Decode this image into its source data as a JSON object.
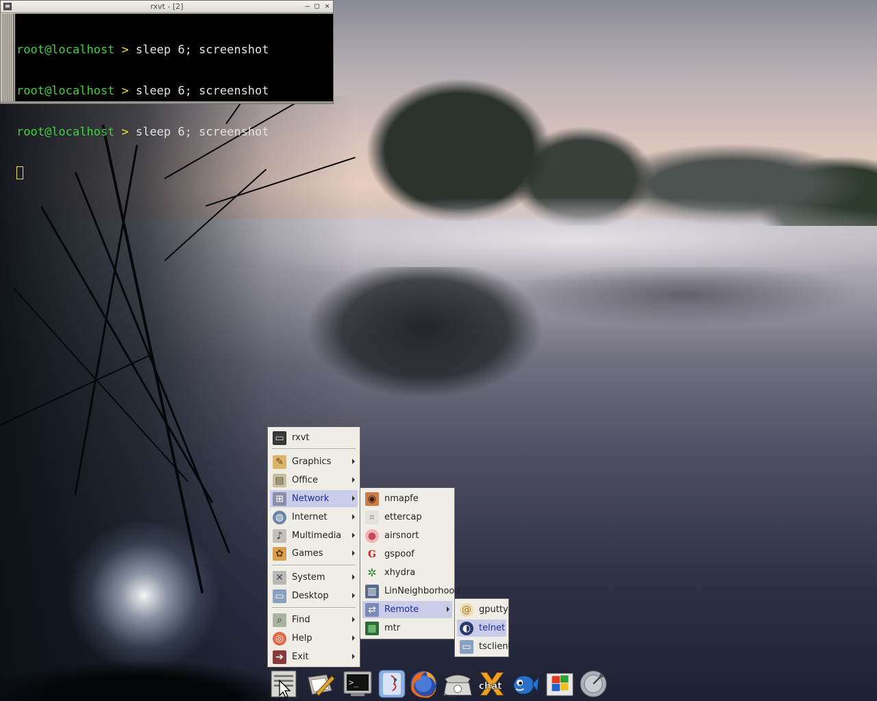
{
  "terminal": {
    "title": "rxvt - [2]",
    "lines": [
      {
        "user": "root@localhost",
        "arrow": ">",
        "command": "sleep 6; screenshot"
      },
      {
        "user": "root@localhost",
        "arrow": ">",
        "command": "sleep 6; screenshot"
      },
      {
        "user": "root@localhost",
        "arrow": ">",
        "command": "sleep 6; screenshot"
      }
    ],
    "buttons": {
      "minimize": "—",
      "maximize": "□",
      "close": "✕"
    }
  },
  "main_menu": {
    "items": [
      {
        "label": "rxvt",
        "icon": "terminal-icon",
        "submenu": false
      },
      {
        "label": "Graphics",
        "icon": "paintbrush-icon",
        "submenu": true
      },
      {
        "label": "Office",
        "icon": "office-icon",
        "submenu": true
      },
      {
        "label": "Network",
        "icon": "network-icon",
        "submenu": true,
        "active": true
      },
      {
        "label": "Internet",
        "icon": "globe-icon",
        "submenu": true
      },
      {
        "label": "Multimedia",
        "icon": "multimedia-icon",
        "submenu": true
      },
      {
        "label": "Games",
        "icon": "games-icon",
        "submenu": true
      },
      {
        "label": "System",
        "icon": "tools-icon",
        "submenu": true
      },
      {
        "label": "Desktop",
        "icon": "monitor-icon",
        "submenu": true
      },
      {
        "label": "Find",
        "icon": "find-icon",
        "submenu": true
      },
      {
        "label": "Help",
        "icon": "lifebuoy-icon",
        "submenu": true
      },
      {
        "label": "Exit",
        "icon": "exit-icon",
        "submenu": true
      }
    ]
  },
  "network_menu": {
    "items": [
      {
        "label": "nmapfe",
        "icon": "eye-icon"
      },
      {
        "label": "ettercap",
        "icon": "ettercap-icon"
      },
      {
        "label": "airsnort",
        "icon": "pig-icon"
      },
      {
        "label": "gspoof",
        "icon": "gspoof-icon"
      },
      {
        "label": "xhydra",
        "icon": "hydra-icon"
      },
      {
        "label": "LinNeighborhood",
        "icon": "server-icon"
      },
      {
        "label": "Remote",
        "icon": "remote-icon",
        "submenu": true,
        "active": true
      },
      {
        "label": "mtr",
        "icon": "mtr-icon"
      }
    ]
  },
  "remote_menu": {
    "items": [
      {
        "label": "gputty",
        "icon": "shell-icon"
      },
      {
        "label": "telnet",
        "icon": "telnet-icon",
        "active": true
      },
      {
        "label": "tsclient",
        "icon": "tsclient-icon"
      }
    ]
  },
  "taskbar": {
    "launchers": [
      {
        "name": "start-menu",
        "icon": "menu-cursor-icon"
      },
      {
        "name": "text-editor",
        "icon": "pen-icon"
      },
      {
        "name": "terminal",
        "icon": "terminal-icon"
      },
      {
        "name": "file-manager",
        "icon": "face-icon"
      },
      {
        "name": "firefox",
        "icon": "firefox-icon"
      },
      {
        "name": "phone",
        "icon": "phone-icon"
      },
      {
        "name": "xchat",
        "icon": "xchat-icon",
        "label": "chat"
      },
      {
        "name": "gaim",
        "icon": "fish-icon"
      },
      {
        "name": "rdesktop",
        "icon": "windows-icon"
      },
      {
        "name": "satellite",
        "icon": "dish-icon"
      }
    ]
  },
  "colors": {
    "prompt_user": "#3fd23f",
    "prompt_arrow": "#f0e23c",
    "menu_bg": "#efede6",
    "menu_active_bg": "#c9cdea",
    "menu_active_text": "#1f2aa0"
  }
}
